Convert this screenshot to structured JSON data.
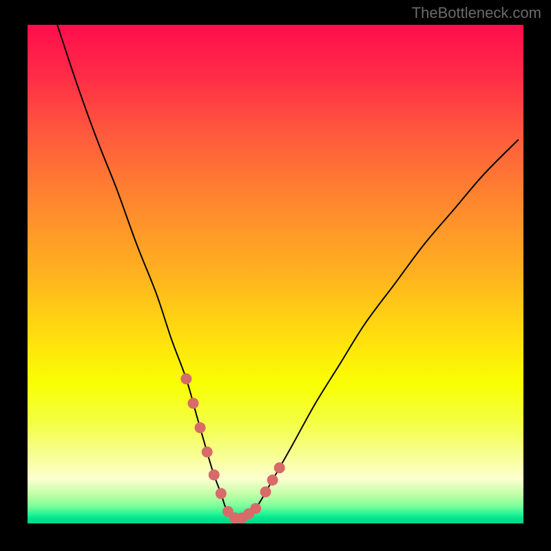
{
  "watermark": "TheBottleneck.com",
  "chart_data": {
    "type": "line",
    "title": "",
    "xlabel": "",
    "ylabel": "",
    "xlim": [
      0,
      100
    ],
    "ylim": [
      0,
      100
    ],
    "series": [
      {
        "name": "bottleneck-curve",
        "x": [
          6,
          10,
          14,
          18,
          22,
          26,
          29,
          32,
          34,
          36,
          37.5,
          39,
          40,
          41,
          42,
          43,
          44,
          46,
          49,
          53,
          58,
          63,
          68,
          74,
          80,
          86,
          92,
          99
        ],
        "y": [
          100,
          88,
          77,
          67,
          56,
          46,
          37,
          29,
          22,
          15,
          10,
          6,
          3,
          1.5,
          1,
          1,
          1.5,
          3,
          8,
          15,
          24,
          32,
          40,
          48,
          56,
          63,
          70,
          77
        ]
      }
    ],
    "highlight_segments": [
      {
        "name": "left-wall-dots",
        "x_range": [
          32,
          38
        ],
        "color": "#d86a6a"
      },
      {
        "name": "valley-dots",
        "x_range": [
          39,
          47
        ],
        "color": "#d86a6a"
      },
      {
        "name": "right-wall-dots",
        "x_range": [
          48,
          52
        ],
        "color": "#d86a6a"
      }
    ],
    "background_gradient": {
      "top": "#ff0d4d",
      "mid": "#ffe40c",
      "bottom": "#00d786"
    }
  }
}
